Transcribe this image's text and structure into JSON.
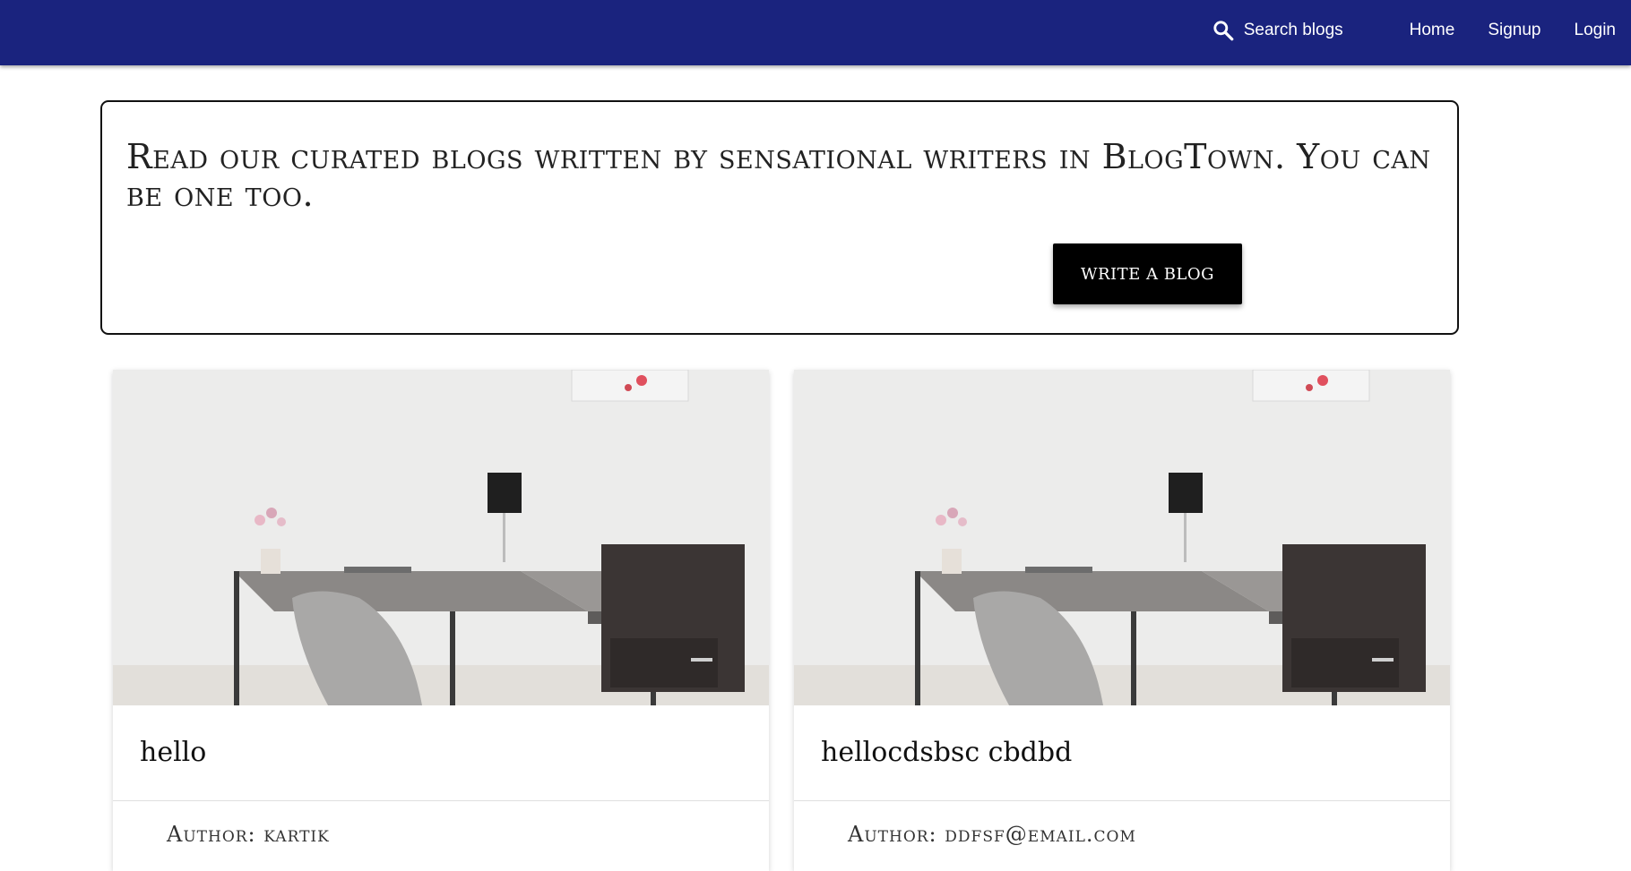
{
  "navbar": {
    "background": "#1a237e",
    "search": {
      "icon": "search-icon",
      "label": "Search blogs"
    },
    "links": [
      "Home",
      "Signup",
      "Login"
    ]
  },
  "hero": {
    "text": "Read our curated blogs written by sensational writers in BlogTown. You can be one too.",
    "button_label": "WRITE A BLOG"
  },
  "posts": [
    {
      "title": "hello",
      "author_prefix": "Author:",
      "author": "kartik"
    },
    {
      "title": "hellocdsbsc cbdbd",
      "author_prefix": "Author:",
      "author": "ddfsf@email.com"
    }
  ]
}
